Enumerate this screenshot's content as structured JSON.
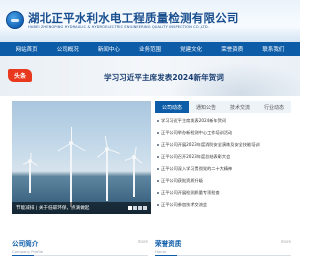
{
  "header": {
    "company_name": "湖北正平水利水电工程质量检测有限公司",
    "company_name_en": "HUBEI ZHENGPING HYDRAULIC & HYDROELECTRIC ENGINEERING QUALITY INSPECTION CO.,LTD."
  },
  "nav": {
    "items": [
      "网站首页",
      "公司概况",
      "新闻中心",
      "业务范围",
      "党建文化",
      "荣誉资质",
      "联系我们"
    ]
  },
  "banner": {
    "badge": "头条",
    "headline": "学习习近平主席发表2024新年贺词"
  },
  "photo": {
    "caption": "节能减排 | 关于低碳环保，点滴做起"
  },
  "news": {
    "tabs": [
      "公司动态",
      "通知公告",
      "技术交流",
      "行业动态"
    ],
    "items": [
      "学习习近平主席发表2024新年贺词",
      "正平公司举办新检测中心工作培训活动",
      "正平公司开展2023年度消防安全演练及安全技能培训",
      "正平公司召开2023年度总结表彰大会",
      "正平公司深入学习贯彻党的二十大精神",
      "正平公司获批资质升级",
      "正平公司开展检测质量专项检查",
      "正平公司参加技术交流会"
    ],
    "more_text": "更多"
  },
  "sections": {
    "profile_title": "公司简介",
    "profile_sub": "Company Profile",
    "honor_title": "荣誉资质",
    "honor_sub": "Honor",
    "more": "more"
  }
}
